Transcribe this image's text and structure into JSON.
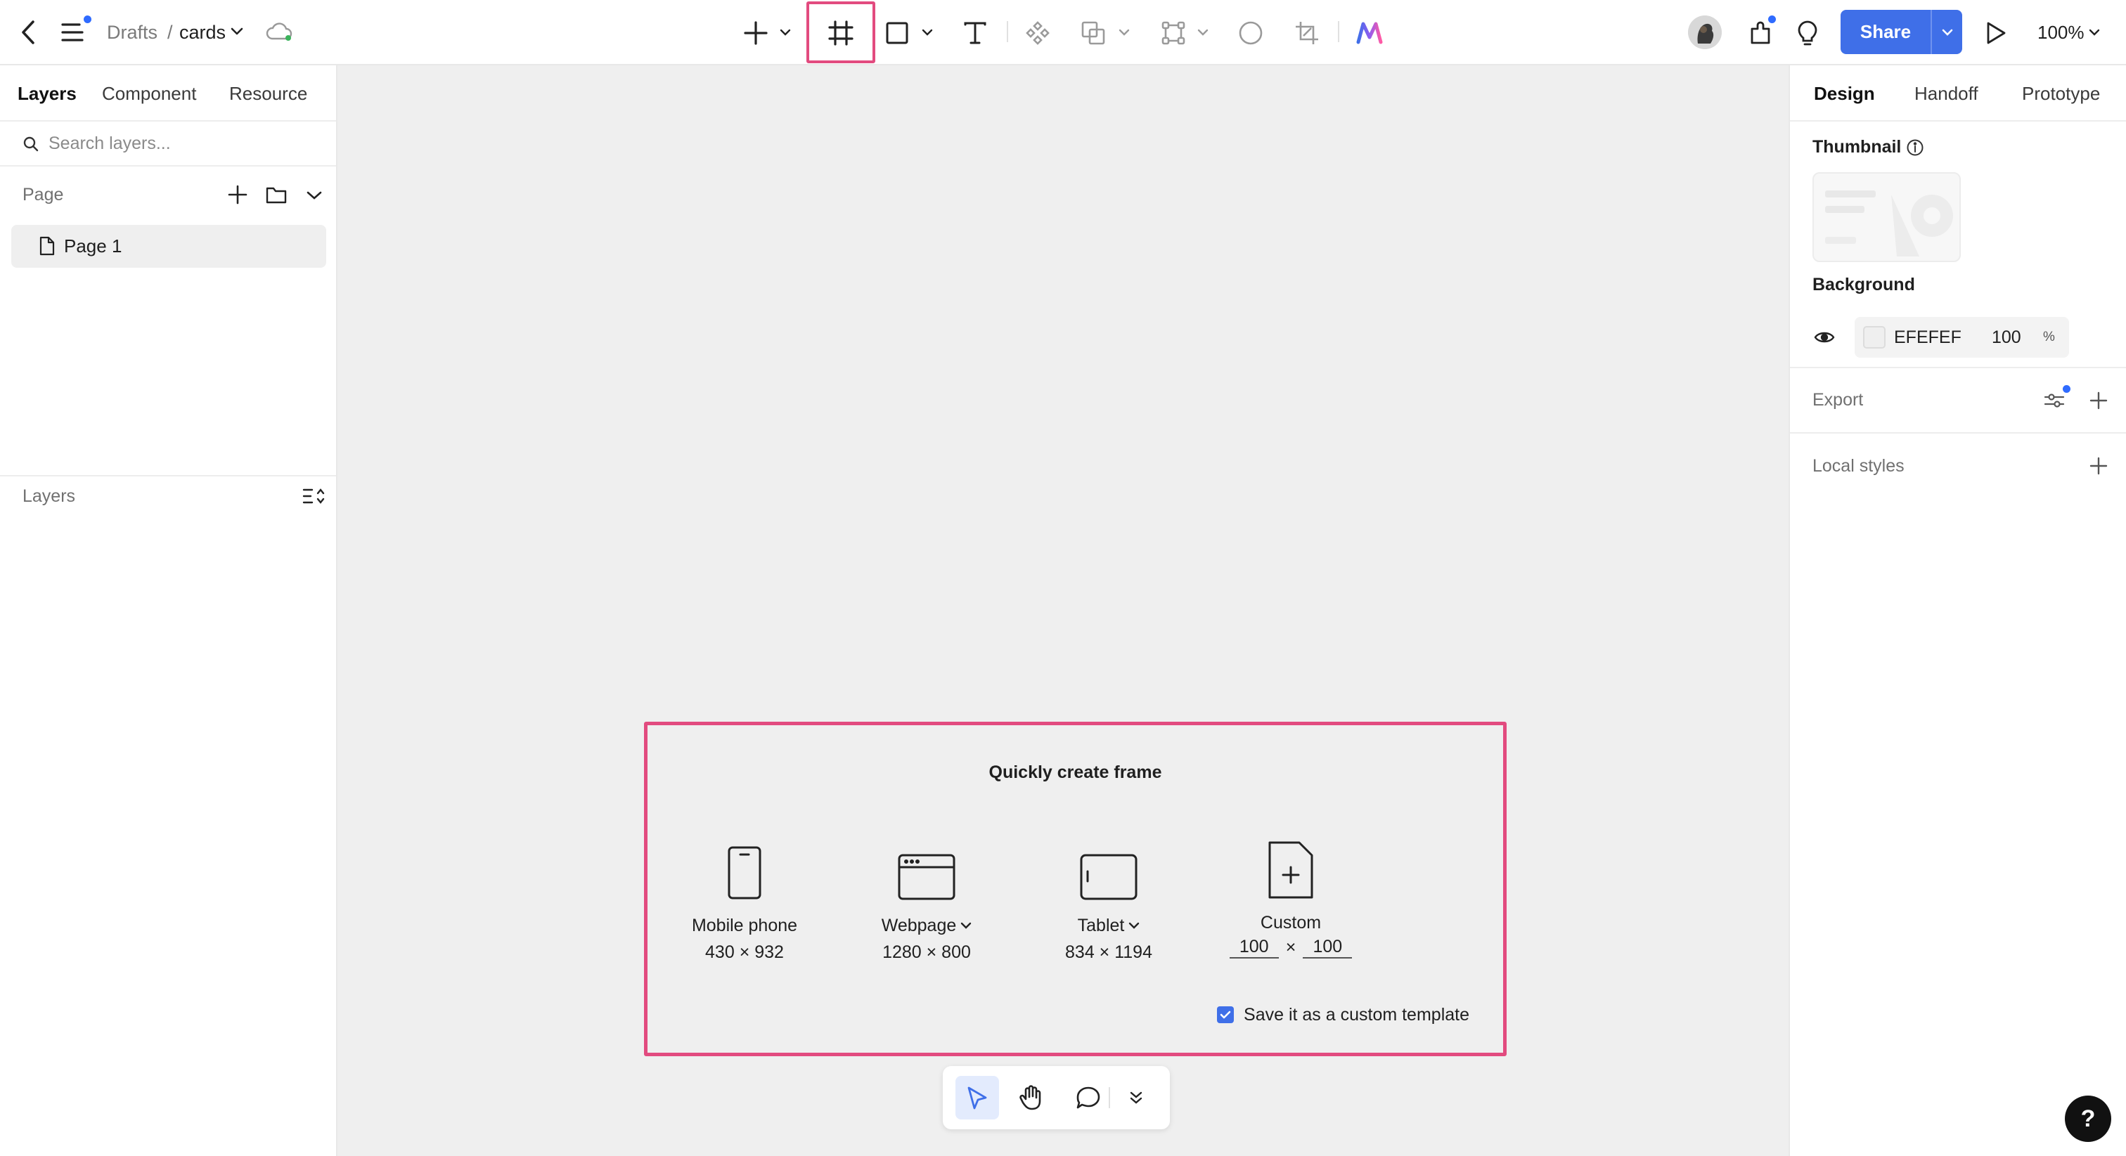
{
  "topbar": {
    "breadcrumb_root": "Drafts",
    "breadcrumb_sep": "/",
    "file_name": "cards",
    "share_label": "Share",
    "zoom_label": "100%",
    "icons": [
      "back-icon",
      "menu-icon",
      "cloud-sync-icon",
      "add-icon",
      "frame-icon",
      "rectangle-icon",
      "text-icon",
      "component-icon",
      "boolean-icon",
      "vector-icon",
      "ellipse-icon",
      "crop-icon",
      "ai-logo-icon",
      "avatar",
      "plugins-icon",
      "lightbulb-icon",
      "play-icon"
    ]
  },
  "left_panel": {
    "tabs": [
      "Layers",
      "Component",
      "Resource"
    ],
    "search_placeholder": "Search layers...",
    "page_section_title": "Page",
    "pages": [
      "Page 1"
    ],
    "layers_section_title": "Layers"
  },
  "quick_create": {
    "title": "Quickly create frame",
    "presets": [
      {
        "name": "Mobile phone",
        "size": "430 × 932"
      },
      {
        "name": "Webpage",
        "size": "1280 × 800"
      },
      {
        "name": "Tablet",
        "size": "834 × 1194"
      }
    ],
    "custom": {
      "name": "Custom",
      "width": "100",
      "times": "×",
      "height": "100"
    },
    "save_template_label": "Save it as a custom template",
    "save_template_checked": true
  },
  "bottom_tools": [
    "move-tool",
    "hand-tool",
    "comment-tool",
    "more-tools"
  ],
  "right_panel": {
    "tabs": [
      "Design",
      "Handoff",
      "Prototype"
    ],
    "thumbnail_label": "Thumbnail",
    "background_label": "Background",
    "background_hex": "EFEFEF",
    "background_opacity": "100",
    "background_opacity_unit": "%",
    "export_label": "Export",
    "local_styles_label": "Local styles"
  },
  "help_label": "?",
  "colors": {
    "accent": "#3f6fe8",
    "highlight": "#e24b7f",
    "canvas": "#efefef",
    "notification_dot": "#2f6bff"
  }
}
